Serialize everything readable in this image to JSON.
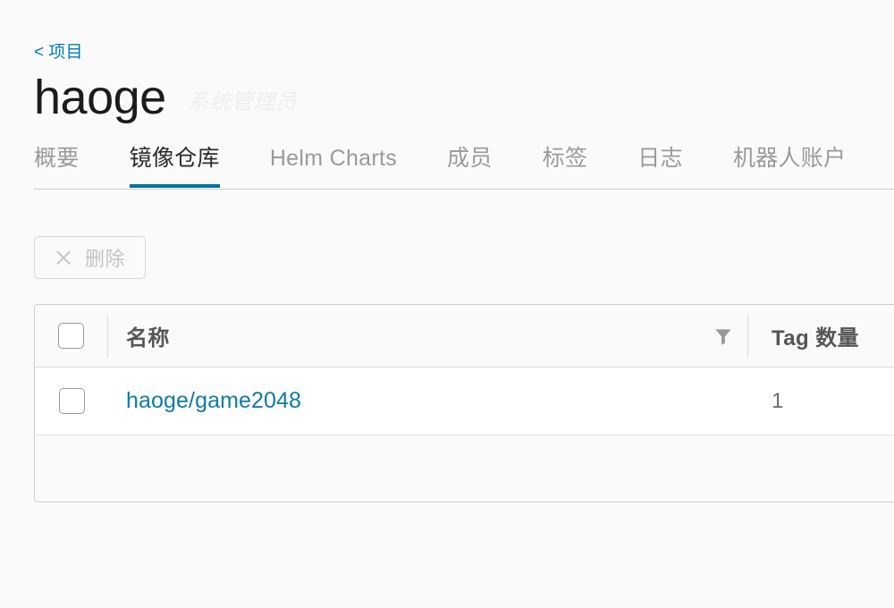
{
  "breadcrumb": {
    "chevron": "<",
    "label": "项目"
  },
  "header": {
    "project_name": "haoge",
    "role_label": "系统管理员"
  },
  "tabs": [
    {
      "label": "概要",
      "name": "tab-summary",
      "active": false
    },
    {
      "label": "镜像仓库",
      "name": "tab-repositories",
      "active": true
    },
    {
      "label": "Helm Charts",
      "name": "tab-helm-charts",
      "active": false
    },
    {
      "label": "成员",
      "name": "tab-members",
      "active": false
    },
    {
      "label": "标签",
      "name": "tab-labels",
      "active": false
    },
    {
      "label": "日志",
      "name": "tab-logs",
      "active": false
    },
    {
      "label": "机器人账户",
      "name": "tab-robot-accounts",
      "active": false
    }
  ],
  "toolbar": {
    "delete_label": "删除",
    "delete_icon": "close-icon",
    "delete_disabled": true
  },
  "table": {
    "columns": [
      {
        "key": "name",
        "label": "名称",
        "has_filter": true
      },
      {
        "key": "tags",
        "label": "Tag 数量",
        "has_filter": false
      }
    ],
    "filter_icon": "filter-funnel-icon",
    "rows": [
      {
        "selected": false,
        "name": "haoge/game2048",
        "tag_count": "1"
      }
    ],
    "footer_text": ""
  },
  "colors": {
    "accent": "#0072a3",
    "link": "#0f7aa8",
    "breadcrumb": "#007CBB",
    "page_bg": "#fafafa",
    "row_bg": "#ffffff",
    "border": "#cdcdcd",
    "muted_text": "#9a9a9a"
  }
}
